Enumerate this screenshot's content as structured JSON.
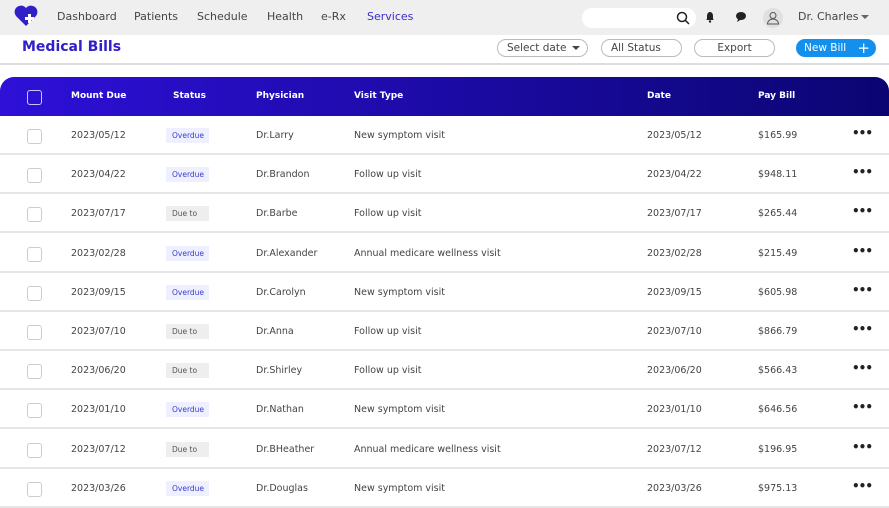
{
  "nav": {
    "logo_text": "NH",
    "items": [
      "Dashboard",
      "Patients",
      "Schedule",
      "Health",
      "e-Rx",
      "Services"
    ],
    "active": "Services",
    "user": "Dr. Charles",
    "search_placeholder": ""
  },
  "page": {
    "title": "Medical Bills",
    "select_date": "Select date",
    "all_status": "All Status",
    "export": "Export",
    "new_bill": "New Bill"
  },
  "table": {
    "headers": [
      "Mount Due",
      "Status",
      "Physician",
      "Visit Type",
      "Date",
      "Pay Bill"
    ],
    "rows": [
      {
        "due": "2023/05/12",
        "status": "Overdue",
        "physician": "Dr.Larry",
        "visit": "New symptom visit",
        "date": "2023/05/12",
        "pay": "$165.99"
      },
      {
        "due": "2023/04/22",
        "status": "Overdue",
        "physician": "Dr.Brandon",
        "visit": "Follow up visit",
        "date": "2023/04/22",
        "pay": "$948.11"
      },
      {
        "due": "2023/07/17",
        "status": "Due to",
        "physician": "Dr.Barbe",
        "visit": "Follow up visit",
        "date": "2023/07/17",
        "pay": "$265.44"
      },
      {
        "due": "2023/02/28",
        "status": "Overdue",
        "physician": "Dr.Alexander",
        "visit": "Annual medicare wellness visit",
        "date": "2023/02/28",
        "pay": "$215.49"
      },
      {
        "due": "2023/09/15",
        "status": "Overdue",
        "physician": "Dr.Carolyn",
        "visit": "New symptom visit",
        "date": "2023/09/15",
        "pay": "$605.98"
      },
      {
        "due": "2023/07/10",
        "status": "Due to",
        "physician": "Dr.Anna",
        "visit": "Follow up visit",
        "date": "2023/07/10",
        "pay": "$866.79"
      },
      {
        "due": "2023/06/20",
        "status": "Due to",
        "physician": "Dr.Shirley",
        "visit": "Follow up visit",
        "date": "2023/06/20",
        "pay": "$566.43"
      },
      {
        "due": "2023/01/10",
        "status": "Overdue",
        "physician": "Dr.Nathan",
        "visit": "New symptom visit",
        "date": "2023/01/10",
        "pay": "$646.56"
      },
      {
        "due": "2023/07/12",
        "status": "Due to",
        "physician": "Dr.BHeather",
        "visit": "Annual medicare wellness visit",
        "date": "2023/07/12",
        "pay": "$196.95"
      },
      {
        "due": "2023/03/26",
        "status": "Overdue",
        "physician": "Dr.Douglas",
        "visit": "New symptom visit",
        "date": "2023/03/26",
        "pay": "$975.13"
      }
    ]
  },
  "colors": {
    "accent": "#3120c8",
    "header_start": "#2e10d8",
    "header_end": "#0a0572",
    "new_bill": "#1390ee",
    "overdue_bg": "#eef0ff",
    "overdue_text": "#3b3bd0",
    "dueto_bg": "#eeeeee"
  }
}
